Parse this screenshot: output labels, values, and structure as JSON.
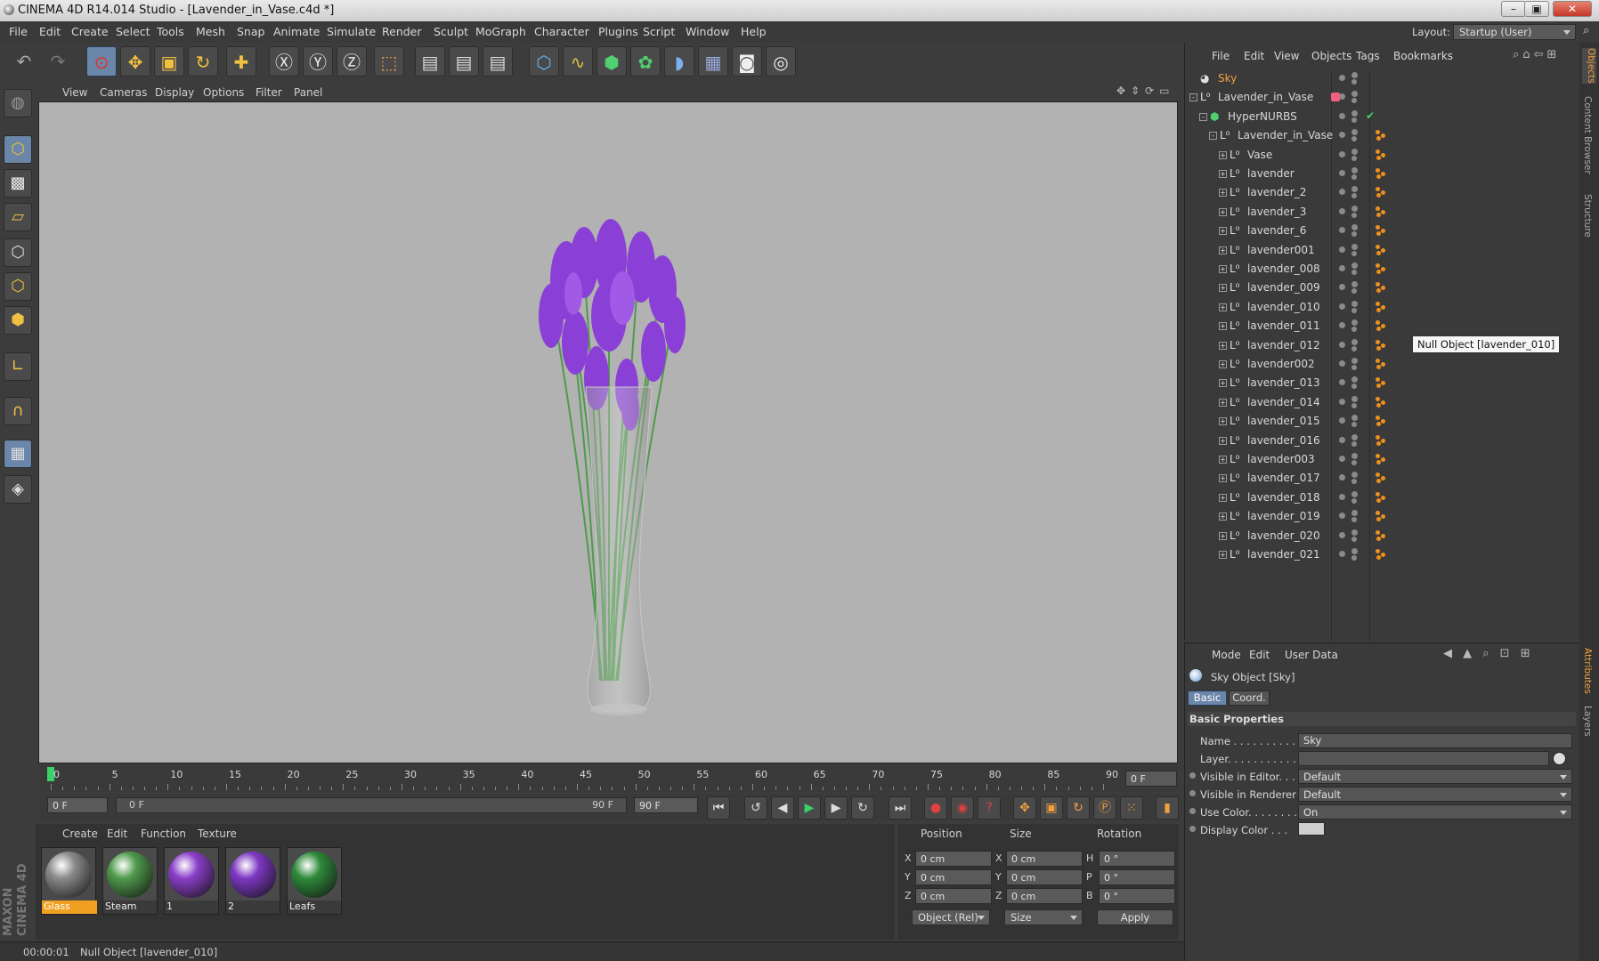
{
  "window": {
    "title": "CINEMA 4D R14.014 Studio - [Lavender_in_Vase.c4d *]"
  },
  "menu": [
    "File",
    "Edit",
    "Create",
    "Select",
    "Tools",
    "Mesh",
    "Snap",
    "Animate",
    "Simulate",
    "Render",
    "Sculpt",
    "MoGraph",
    "Character",
    "Plugins",
    "Script",
    "Window",
    "Help"
  ],
  "layout": {
    "label": "Layout:",
    "value": "Startup (User)"
  },
  "viewport_menu": [
    "View",
    "Cameras",
    "Display",
    "Options",
    "Filter",
    "Panel"
  ],
  "timeline": {
    "ticks": [
      "0",
      "5",
      "10",
      "15",
      "20",
      "25",
      "30",
      "35",
      "40",
      "45",
      "50",
      "55",
      "60",
      "65",
      "70",
      "75",
      "80",
      "85",
      "90"
    ],
    "current_frame": "0 F",
    "start": "0 F",
    "range_start": "0 F",
    "range_end": "90 F",
    "end": "90 F"
  },
  "material_menu": [
    "Create",
    "Edit",
    "Function",
    "Texture"
  ],
  "materials": [
    {
      "name": "Glass",
      "color": "#8a8a8a",
      "selected": true
    },
    {
      "name": "Steam",
      "color": "#4f9a4c"
    },
    {
      "name": "1",
      "color": "#8a3fc8"
    },
    {
      "name": "2",
      "color": "#7d38c2"
    },
    {
      "name": "Leafs",
      "color": "#2e8a3a"
    }
  ],
  "coords": {
    "headers": [
      "Position",
      "Size",
      "Rotation"
    ],
    "rows": [
      {
        "a": "X",
        "p": "0 cm",
        "b": "X",
        "s": "0 cm",
        "c": "H",
        "r": "0 °"
      },
      {
        "a": "Y",
        "p": "0 cm",
        "b": "Y",
        "s": "0 cm",
        "c": "P",
        "r": "0 °"
      },
      {
        "a": "Z",
        "p": "0 cm",
        "b": "Z",
        "s": "0 cm",
        "c": "B",
        "r": "0 °"
      }
    ],
    "mode": "Object (Rel)",
    "size_mode": "Size",
    "apply": "Apply"
  },
  "status": {
    "time": "00:00:01",
    "message": "Null Object [lavender_010]"
  },
  "objects_menu": [
    "File",
    "Edit",
    "View",
    "Objects",
    "Tags",
    "Bookmarks"
  ],
  "objects": [
    {
      "name": "Sky",
      "indent": 0,
      "icon": "sky",
      "highlight": true
    },
    {
      "name": "Lavender_in_Vase",
      "indent": 0,
      "icon": "null",
      "exp": "-",
      "material": true
    },
    {
      "name": "HyperNURBS",
      "indent": 1,
      "icon": "nurbs",
      "exp": "-",
      "check": true
    },
    {
      "name": "Lavender_in_Vase",
      "indent": 2,
      "icon": "null",
      "exp": "-",
      "tag": true
    },
    {
      "name": "Vase",
      "indent": 3,
      "icon": "null",
      "exp": "+",
      "tag": true
    },
    {
      "name": "lavender",
      "indent": 3,
      "icon": "null",
      "exp": "+",
      "tag": true
    },
    {
      "name": "lavender_2",
      "indent": 3,
      "icon": "null",
      "exp": "+",
      "tag": true
    },
    {
      "name": "lavender_3",
      "indent": 3,
      "icon": "null",
      "exp": "+",
      "tag": true
    },
    {
      "name": "lavender_6",
      "indent": 3,
      "icon": "null",
      "exp": "+",
      "tag": true
    },
    {
      "name": "lavender001",
      "indent": 3,
      "icon": "null",
      "exp": "+",
      "tag": true
    },
    {
      "name": "lavender_008",
      "indent": 3,
      "icon": "null",
      "exp": "+",
      "tag": true
    },
    {
      "name": "lavender_009",
      "indent": 3,
      "icon": "null",
      "exp": "+",
      "tag": true
    },
    {
      "name": "lavender_010",
      "indent": 3,
      "icon": "null",
      "exp": "+",
      "tag": true
    },
    {
      "name": "lavender_011",
      "indent": 3,
      "icon": "null",
      "exp": "+",
      "tag": true
    },
    {
      "name": "lavender_012",
      "indent": 3,
      "icon": "null",
      "exp": "+",
      "tag": true
    },
    {
      "name": "lavender002",
      "indent": 3,
      "icon": "null",
      "exp": "+",
      "tag": true
    },
    {
      "name": "lavender_013",
      "indent": 3,
      "icon": "null",
      "exp": "+",
      "tag": true
    },
    {
      "name": "lavender_014",
      "indent": 3,
      "icon": "null",
      "exp": "+",
      "tag": true
    },
    {
      "name": "lavender_015",
      "indent": 3,
      "icon": "null",
      "exp": "+",
      "tag": true
    },
    {
      "name": "lavender_016",
      "indent": 3,
      "icon": "null",
      "exp": "+",
      "tag": true
    },
    {
      "name": "lavender003",
      "indent": 3,
      "icon": "null",
      "exp": "+",
      "tag": true
    },
    {
      "name": "lavender_017",
      "indent": 3,
      "icon": "null",
      "exp": "+",
      "tag": true
    },
    {
      "name": "lavender_018",
      "indent": 3,
      "icon": "null",
      "exp": "+",
      "tag": true
    },
    {
      "name": "lavender_019",
      "indent": 3,
      "icon": "null",
      "exp": "+",
      "tag": true
    },
    {
      "name": "lavender_020",
      "indent": 3,
      "icon": "null",
      "exp": "+",
      "tag": true
    },
    {
      "name": "lavender_021",
      "indent": 3,
      "icon": "null",
      "exp": "+",
      "tag": true
    }
  ],
  "tooltip": "Null Object [lavender_010]",
  "attributes_menu": [
    "Mode",
    "Edit",
    "User Data"
  ],
  "attributes": {
    "object_title": "Sky Object [Sky]",
    "tabs": [
      "Basic",
      "Coord."
    ],
    "section": "Basic Properties",
    "fields": [
      {
        "label": "Name . . . . . . . . . . .",
        "value": "Sky",
        "type": "text"
      },
      {
        "label": "Layer. . . . . . . . . . .",
        "value": "",
        "type": "layer"
      },
      {
        "label": "Visible in Editor. . .",
        "value": "Default",
        "type": "select"
      },
      {
        "label": "Visible in Renderer",
        "value": "Default",
        "type": "select"
      },
      {
        "label": "Use Color. . . . . . . .",
        "value": "On",
        "type": "select"
      },
      {
        "label": "Display Color . . .",
        "value": "",
        "type": "color"
      }
    ]
  },
  "side_tabs": [
    "Objects",
    "Content Browser",
    "Structure",
    "Attributes",
    "Layers"
  ],
  "brand": "MAXON CINEMA 4D"
}
